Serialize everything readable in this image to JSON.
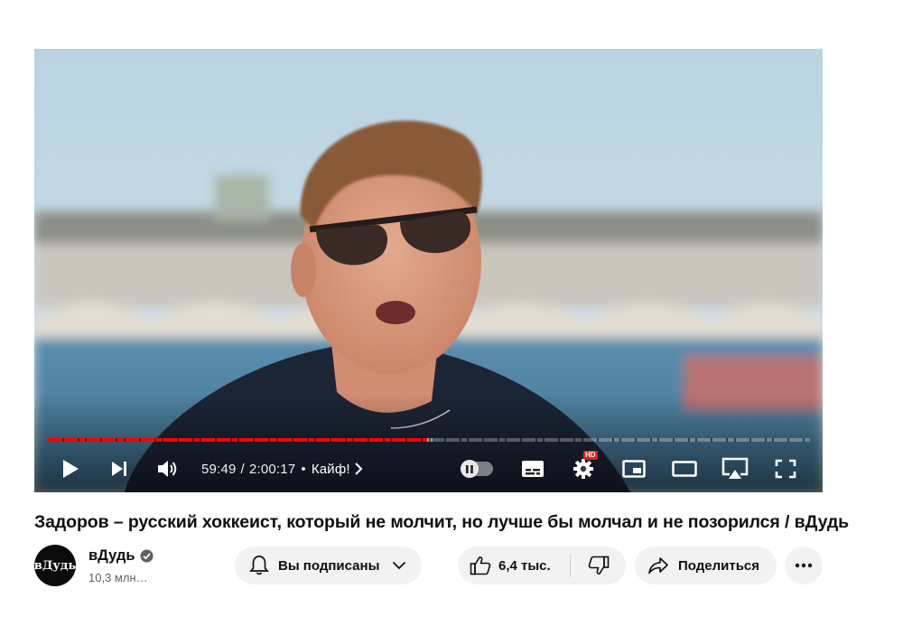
{
  "player": {
    "time_current": "59:49",
    "time_separator": "/",
    "time_total": "2:00:17",
    "chapter_separator": "•",
    "chapter_title": "Кайф!",
    "progress_played": 0.4978,
    "progress_buffered": 0.505,
    "hd_badge": "HD",
    "autoplay_on": false,
    "accent_color": "#ff0000"
  },
  "video": {
    "title": "Задоров – русский хоккеист, который не молчит, но лучше бы молчал и не позорился / вДудь"
  },
  "channel": {
    "avatar_text": "вДудь",
    "name": "вДудь",
    "verified": true,
    "subscribers": "10,3 млн…"
  },
  "actions": {
    "subscribe_label": "Вы подписаны",
    "like_count": "6,4 тыс.",
    "share_label": "Поделиться"
  }
}
